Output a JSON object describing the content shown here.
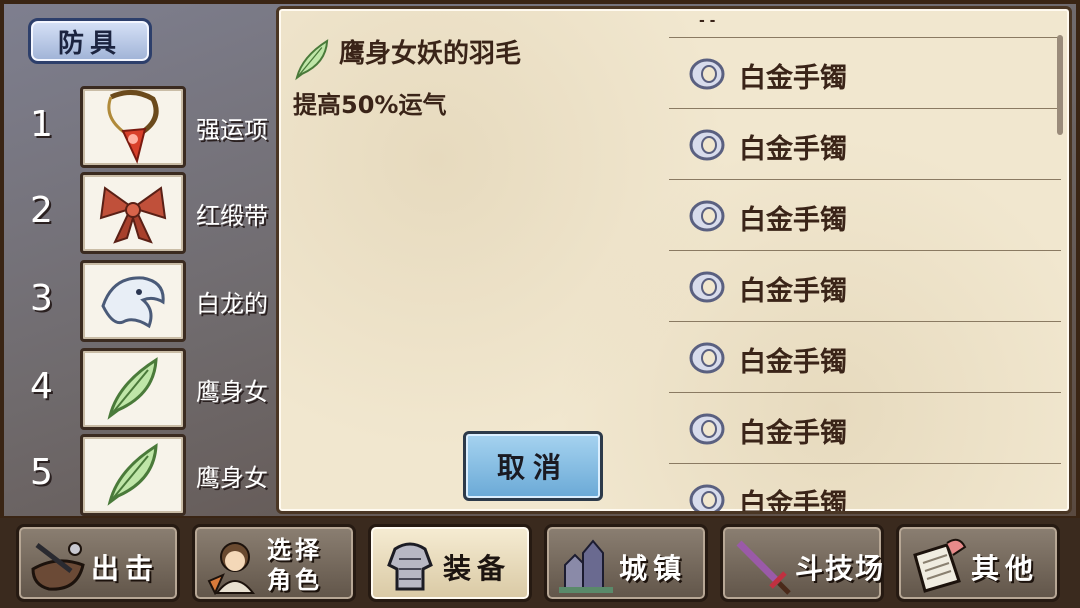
{
  "section_tag": "防具",
  "slots": [
    {
      "num": "1",
      "name": "强运项",
      "icon": "amulet-icon"
    },
    {
      "num": "2",
      "name": "红缎带",
      "icon": "ribbon-icon"
    },
    {
      "num": "3",
      "name": "白龙的",
      "icon": "white-dragon-icon"
    },
    {
      "num": "4",
      "name": "鹰身女",
      "icon": "feather-icon"
    },
    {
      "num": "5",
      "name": "鹰身女",
      "icon": "feather-icon"
    }
  ],
  "detail": {
    "name": "鹰身女妖的羽毛",
    "description": "提高50%运气",
    "icon": "feather-icon"
  },
  "list": {
    "top_marker": "- -",
    "items": [
      {
        "label": "白金手镯",
        "icon": "bracelet-icon"
      },
      {
        "label": "白金手镯",
        "icon": "bracelet-icon"
      },
      {
        "label": "白金手镯",
        "icon": "bracelet-icon"
      },
      {
        "label": "白金手镯",
        "icon": "bracelet-icon"
      },
      {
        "label": "白金手镯",
        "icon": "bracelet-icon"
      },
      {
        "label": "白金手镯",
        "icon": "bracelet-icon"
      },
      {
        "label": "白金手镯",
        "icon": "bracelet-icon"
      }
    ]
  },
  "cancel_label": "取消",
  "nav": [
    {
      "label": "出击",
      "icon": "sortie-icon"
    },
    {
      "label": "选择角色",
      "icon": "character-icon"
    },
    {
      "label": "装备",
      "icon": "armor-icon",
      "active": true
    },
    {
      "label": "城镇",
      "icon": "town-icon"
    },
    {
      "label": "斗技场",
      "icon": "sword-icon"
    },
    {
      "label": "其他",
      "icon": "scroll-icon"
    }
  ],
  "colors": {
    "dialog_bg": "#f1e7cf",
    "cancel_button": "#6aa9d6",
    "tag_border": "#2d3f6b"
  }
}
